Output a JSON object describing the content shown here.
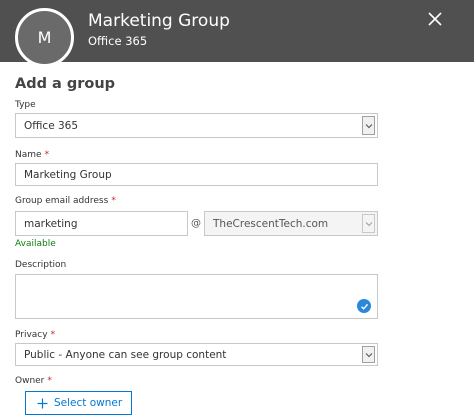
{
  "header": {
    "avatar_letter": "M",
    "title": "Marketing Group",
    "subtitle": "Office 365"
  },
  "form": {
    "section_title": "Add a group",
    "type": {
      "label": "Type",
      "value": "Office 365"
    },
    "name": {
      "label": "Name",
      "value": "Marketing Group",
      "required": "*"
    },
    "email": {
      "label": "Group email address",
      "required": "*",
      "value": "marketing",
      "at": "@",
      "domain": "TheCrescentTech.com",
      "status": "Available"
    },
    "description": {
      "label": "Description",
      "value": ""
    },
    "privacy": {
      "label": "Privacy",
      "required": "*",
      "value": "Public - Anyone can see group content"
    },
    "owner": {
      "label": "Owner",
      "required": "*",
      "button_label": "Select owner"
    }
  },
  "colors": {
    "header_bg": "#505050",
    "accent": "#0078d4",
    "required": "#c4262e",
    "available": "#107c10"
  },
  "icons": [
    "close-icon",
    "chevron-down-icon",
    "checkmark-icon",
    "plus-icon"
  ]
}
